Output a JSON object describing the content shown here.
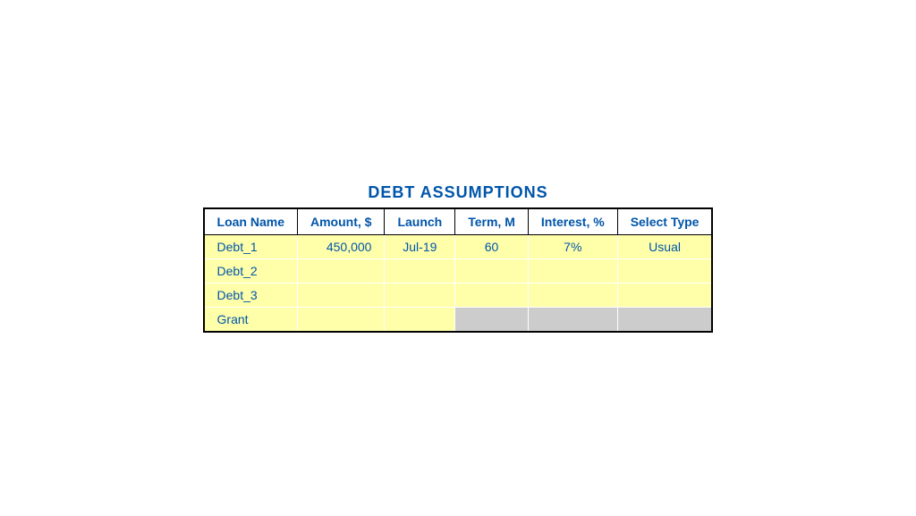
{
  "title": "DEBT ASSUMPTIONS",
  "columns": [
    {
      "label": "Loan Name",
      "key": "loan_name"
    },
    {
      "label": "Amount, $",
      "key": "amount"
    },
    {
      "label": "Launch",
      "key": "launch"
    },
    {
      "label": "Term, M",
      "key": "term"
    },
    {
      "label": "Interest, %",
      "key": "interest"
    },
    {
      "label": "Select Type",
      "key": "select_type"
    }
  ],
  "rows": [
    {
      "loan_name": "Debt_1",
      "amount": "450,000",
      "launch": "Jul-19",
      "term": "60",
      "interest": "7%",
      "select_type": "Usual",
      "gray_cols": []
    },
    {
      "loan_name": "Debt_2",
      "amount": "",
      "launch": "",
      "term": "",
      "interest": "",
      "select_type": "",
      "gray_cols": []
    },
    {
      "loan_name": "Debt_3",
      "amount": "",
      "launch": "",
      "term": "",
      "interest": "",
      "select_type": "",
      "gray_cols": []
    },
    {
      "loan_name": "Grant",
      "amount": "",
      "launch": "",
      "term": "",
      "interest": "",
      "select_type": "",
      "gray_cols": [
        "term",
        "interest",
        "select_type"
      ]
    }
  ]
}
